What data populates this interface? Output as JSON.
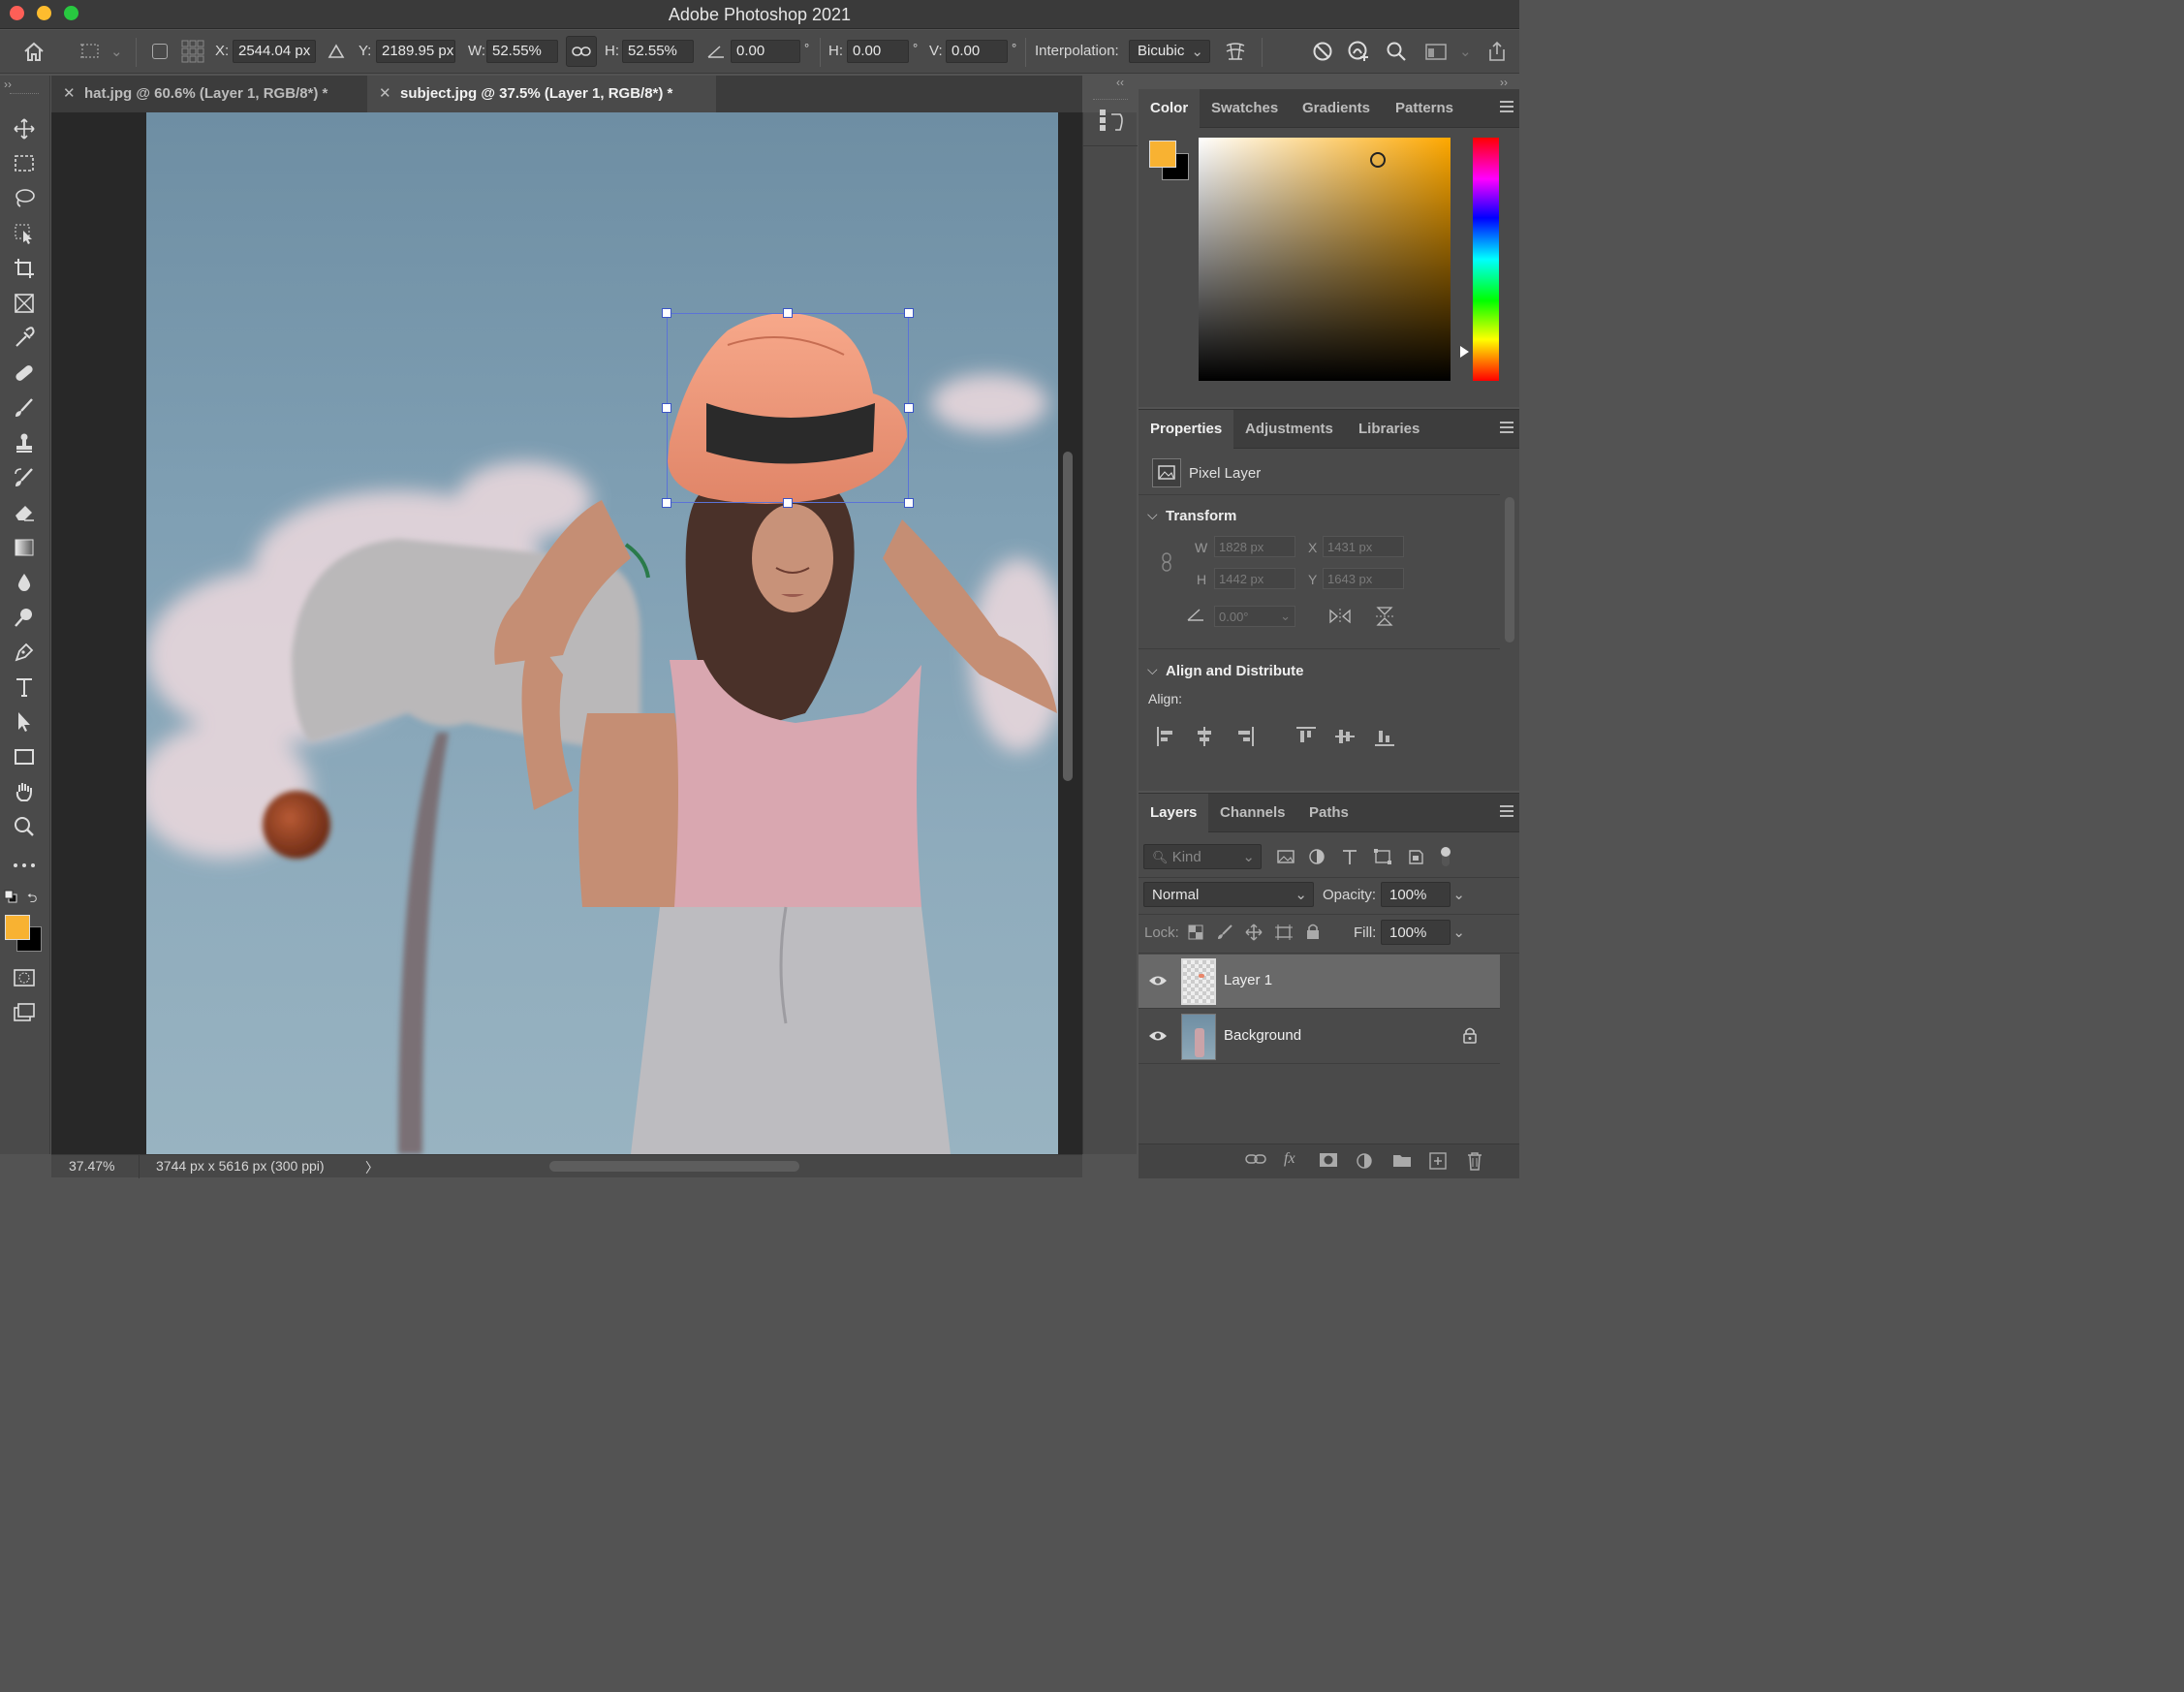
{
  "app": {
    "title": "Adobe Photoshop 2021"
  },
  "options": {
    "x_label": "X:",
    "x_value": "2544.04 px",
    "y_label": "Y:",
    "y_value": "2189.95 px",
    "w_label": "W:",
    "w_value": "52.55%",
    "h_label": "H:",
    "h_value": "52.55%",
    "angle_value": "0.00",
    "angle_unit": "°",
    "hskew_label": "H:",
    "hskew_value": "0.00",
    "hskew_unit": "°",
    "vskew_label": "V:",
    "vskew_value": "0.00",
    "vskew_unit": "°",
    "interp_label": "Interpolation:",
    "interp_value": "Bicubic"
  },
  "tabs": [
    {
      "label": "hat.jpg @ 60.6% (Layer 1, RGB/8*) *",
      "active": false
    },
    {
      "label": "subject.jpg @ 37.5% (Layer 1, RGB/8*) *",
      "active": true
    }
  ],
  "status": {
    "zoom": "37.47%",
    "doc_info": "3744 px x 5616 px (300 ppi)",
    "arrow": "〉"
  },
  "color_panel": {
    "tabs": [
      "Color",
      "Swatches",
      "Gradients",
      "Patterns"
    ],
    "foreground": "#f8b232",
    "background": "#000000"
  },
  "properties": {
    "tabs": [
      "Properties",
      "Adjustments",
      "Libraries"
    ],
    "layer_kind": "Pixel Layer",
    "transform_title": "Transform",
    "w_label": "W",
    "w_value": "1828 px",
    "x_label": "X",
    "x_value": "1431 px",
    "h_label": "H",
    "h_value": "1442 px",
    "y_label": "Y",
    "y_value": "1643 px",
    "angle_value": "0.00°",
    "align_title": "Align and Distribute",
    "align_label": "Align:"
  },
  "layers": {
    "tabs": [
      "Layers",
      "Channels",
      "Paths"
    ],
    "kind_placeholder": "Kind",
    "blend_mode": "Normal",
    "opacity_label": "Opacity:",
    "opacity_value": "100%",
    "lock_label": "Lock:",
    "fill_label": "Fill:",
    "fill_value": "100%",
    "items": [
      {
        "name": "Layer 1",
        "visible": true,
        "selected": true
      },
      {
        "name": "Background",
        "visible": true,
        "locked": true
      }
    ]
  }
}
